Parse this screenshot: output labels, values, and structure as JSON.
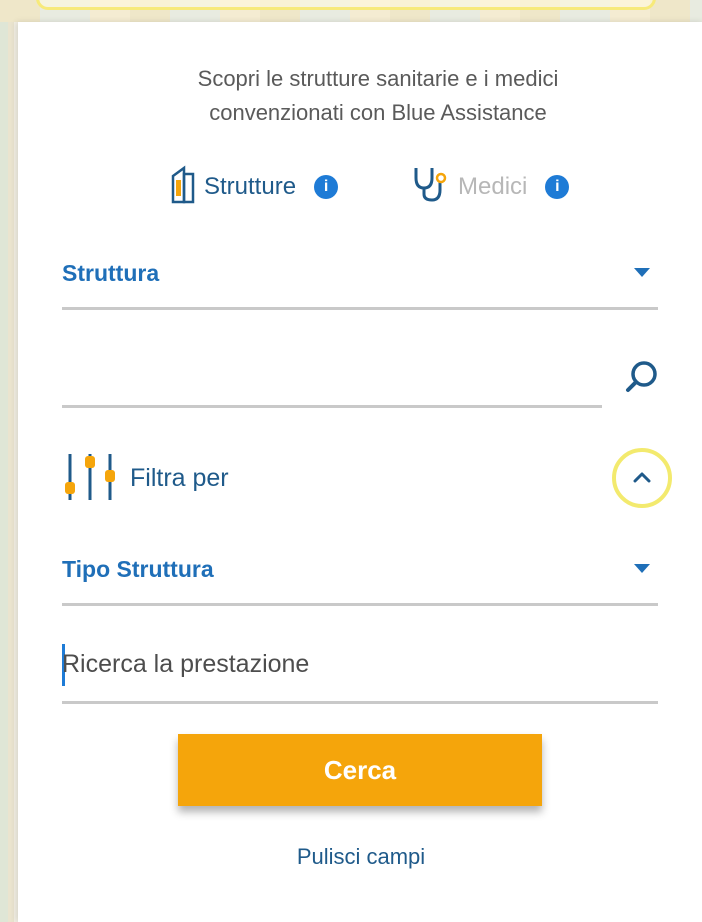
{
  "intro": {
    "line1": "Scopri le strutture sanitarie e i medici",
    "line2": "convenzionati con Blue Assistance"
  },
  "tabs": [
    {
      "label": "Strutture",
      "icon": "building-icon",
      "info_icon": "info-icon",
      "active": true
    },
    {
      "label": "Medici",
      "icon": "stethoscope-icon",
      "info_icon": "info-icon",
      "active": false
    }
  ],
  "form": {
    "type_select": {
      "value": "Struttura",
      "icon": "caret-down-icon"
    },
    "search": {
      "value": "",
      "icon": "search-icon"
    },
    "filter": {
      "label": "Filtra per",
      "icon": "sliders-icon",
      "toggle_icon": "chevron-up-icon"
    },
    "tipo_select": {
      "value": "Tipo Struttura",
      "icon": "caret-down-icon"
    },
    "prestazione": {
      "placeholder": "Ricerca la prestazione"
    }
  },
  "actions": {
    "submit_label": "Cerca",
    "clear_label": "Pulisci campi"
  },
  "colors": {
    "primary_text": "#1f6fb8",
    "accent_button": "#f5a50b",
    "info": "#1e7bd6",
    "inactive": "#b7b7b7"
  }
}
